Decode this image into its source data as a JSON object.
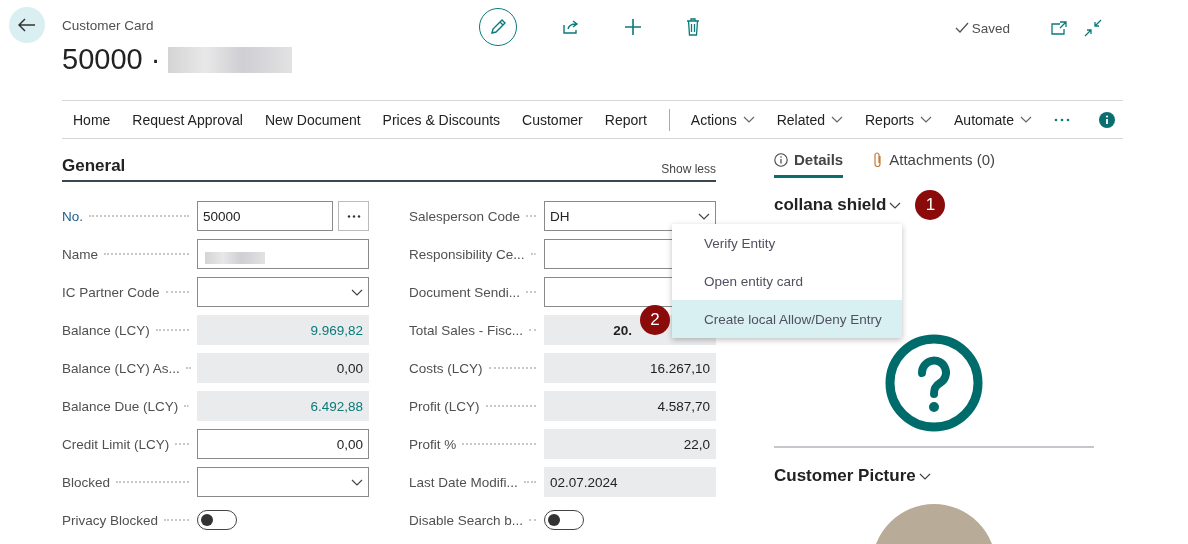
{
  "header": {
    "page_caption": "Customer Card",
    "record_title": "50000 ·",
    "saved": "Saved"
  },
  "action_bar": {
    "items": [
      {
        "label": "Home",
        "kind": "plain"
      },
      {
        "label": "Request Approval",
        "kind": "plain"
      },
      {
        "label": "New Document",
        "kind": "plain"
      },
      {
        "label": "Prices & Discounts",
        "kind": "plain"
      },
      {
        "label": "Customer",
        "kind": "plain"
      },
      {
        "label": "Report",
        "kind": "plain"
      },
      {
        "label": "Actions",
        "kind": "menu"
      },
      {
        "label": "Related",
        "kind": "menu"
      },
      {
        "label": "Reports",
        "kind": "menu"
      },
      {
        "label": "Automate",
        "kind": "menu"
      }
    ]
  },
  "general": {
    "title": "General",
    "show_less": "Show less",
    "fields_left": [
      {
        "label": "No.",
        "kind": "lookup",
        "value": "50000"
      },
      {
        "label": "Name",
        "kind": "redacted"
      },
      {
        "label": "IC Partner Code",
        "kind": "dropdown"
      },
      {
        "label": "Balance (LCY)",
        "kind": "readonly_link",
        "value": "9.969,82"
      },
      {
        "label": "Balance (LCY) As...",
        "kind": "readonly",
        "value": "0,00"
      },
      {
        "label": "Balance Due (LCY)",
        "kind": "readonly_link",
        "value": "6.492,88"
      },
      {
        "label": "Credit Limit (LCY)",
        "kind": "number",
        "value": "0,00"
      },
      {
        "label": "Blocked",
        "kind": "dropdown"
      },
      {
        "label": "Privacy Blocked",
        "kind": "toggle",
        "on": false
      }
    ],
    "fields_right": [
      {
        "label": "Salesperson Code",
        "kind": "dropdown",
        "value": "DH"
      },
      {
        "label": "Responsibility Ce...",
        "kind": "text"
      },
      {
        "label": "Document Sendi...",
        "kind": "text"
      },
      {
        "label": "Total Sales - Fisc...",
        "kind": "readonly_bold",
        "value": "20."
      },
      {
        "label": "Costs (LCY)",
        "kind": "readonly",
        "value": "16.267,10"
      },
      {
        "label": "Profit (LCY)",
        "kind": "readonly",
        "value": "4.587,70"
      },
      {
        "label": "Profit %",
        "kind": "readonly",
        "value": "22,0"
      },
      {
        "label": "Last Date Modifi...",
        "kind": "readonly_left",
        "value": "02.07.2024"
      },
      {
        "label": "Disable Search b...",
        "kind": "toggle",
        "on": false
      }
    ]
  },
  "factbox": {
    "tabs": [
      {
        "label": "Details",
        "kind": "info",
        "selected": true
      },
      {
        "label": "Attachments (0)",
        "kind": "clip",
        "selected": false
      }
    ],
    "entity_title": "collana shield",
    "entity_badge": "1",
    "menu": {
      "items": [
        {
          "label": "Verify Entity",
          "selected": false
        },
        {
          "label": "Open entity card",
          "selected": false
        },
        {
          "label": "Create local Allow/Deny Entry",
          "selected": true
        }
      ],
      "badge": "2"
    },
    "picture_title": "Customer Picture"
  }
}
